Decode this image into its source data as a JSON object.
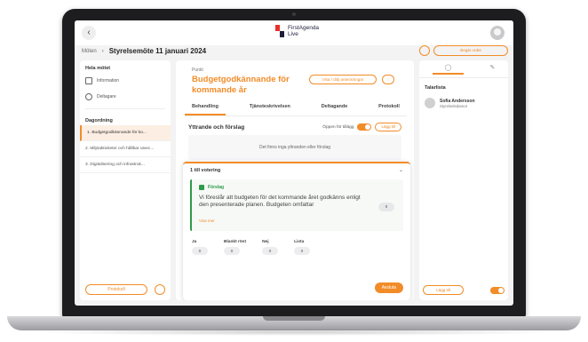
{
  "app": {
    "brand_line1": "FirstAgenda",
    "brand_line2": "Live",
    "brand_colors": [
      "#e8302c",
      "#1e1e3c"
    ]
  },
  "breadcrumb": {
    "parent": "Möten",
    "current": "Styrelsemöte 11 januari 2024"
  },
  "sidebar": {
    "heading": "Hela mötet",
    "items": [
      {
        "label": "Information",
        "icon": "info-icon"
      },
      {
        "label": "Deltagare",
        "icon": "people-icon"
      }
    ],
    "agenda_heading": "Dagordning",
    "agenda": [
      {
        "label": "1. Budgetgodkännande för ko...",
        "active": true
      },
      {
        "label": "2. Miljöaktiviteter och hållbar utvec...",
        "active": false
      },
      {
        "label": "3. Digitalisering och infrastruk...",
        "active": false
      }
    ],
    "footer_button": "Protokoll"
  },
  "main": {
    "punkt_label": "Punkt",
    "title": "Budgetgodkännande för kommande år",
    "header_button_1": "Visa / dölj anteckningar",
    "header_button_2": "⋮",
    "tabs": [
      "Behandling",
      "Tjänsteskrivelsen",
      "Deltagande",
      "Protokoll"
    ],
    "active_tab": 0,
    "section_title": "Yttrande och förslag",
    "toggle_label": "Öppen för tillägg",
    "add_button": "Lägg till",
    "empty_text": "Det finns inga yttranden eller förslag",
    "vote": {
      "heading": "1 till votering",
      "proposal_tag": "Förslag",
      "proposal_text": "Vi föreslår att budgeten för det kommande året godkänns enligt den presenterade planen. Budgeten omfattar",
      "proposal_more": "Visa mer",
      "proposal_count": "0",
      "columns": [
        {
          "label": "Ja",
          "count": "0"
        },
        {
          "label": "Blankt röst",
          "count": "0"
        },
        {
          "label": "Nej",
          "count": "0"
        },
        {
          "label": "Lista",
          "count": "0"
        }
      ],
      "submit_button": "Avsluta"
    }
  },
  "right_panel": {
    "request_button": "Begär ordet",
    "tab_1_icon": "user-icon",
    "tab_2_icon": "edit-icon",
    "heading": "Talarlista",
    "speakers": [
      {
        "name": "Sofia Andersson",
        "role": "Styrelseledamot"
      }
    ],
    "footer_button": "Lägg till"
  },
  "colors": {
    "accent": "#f28c28",
    "success": "#2e9b4a",
    "bezel": "#1d1d1f"
  }
}
